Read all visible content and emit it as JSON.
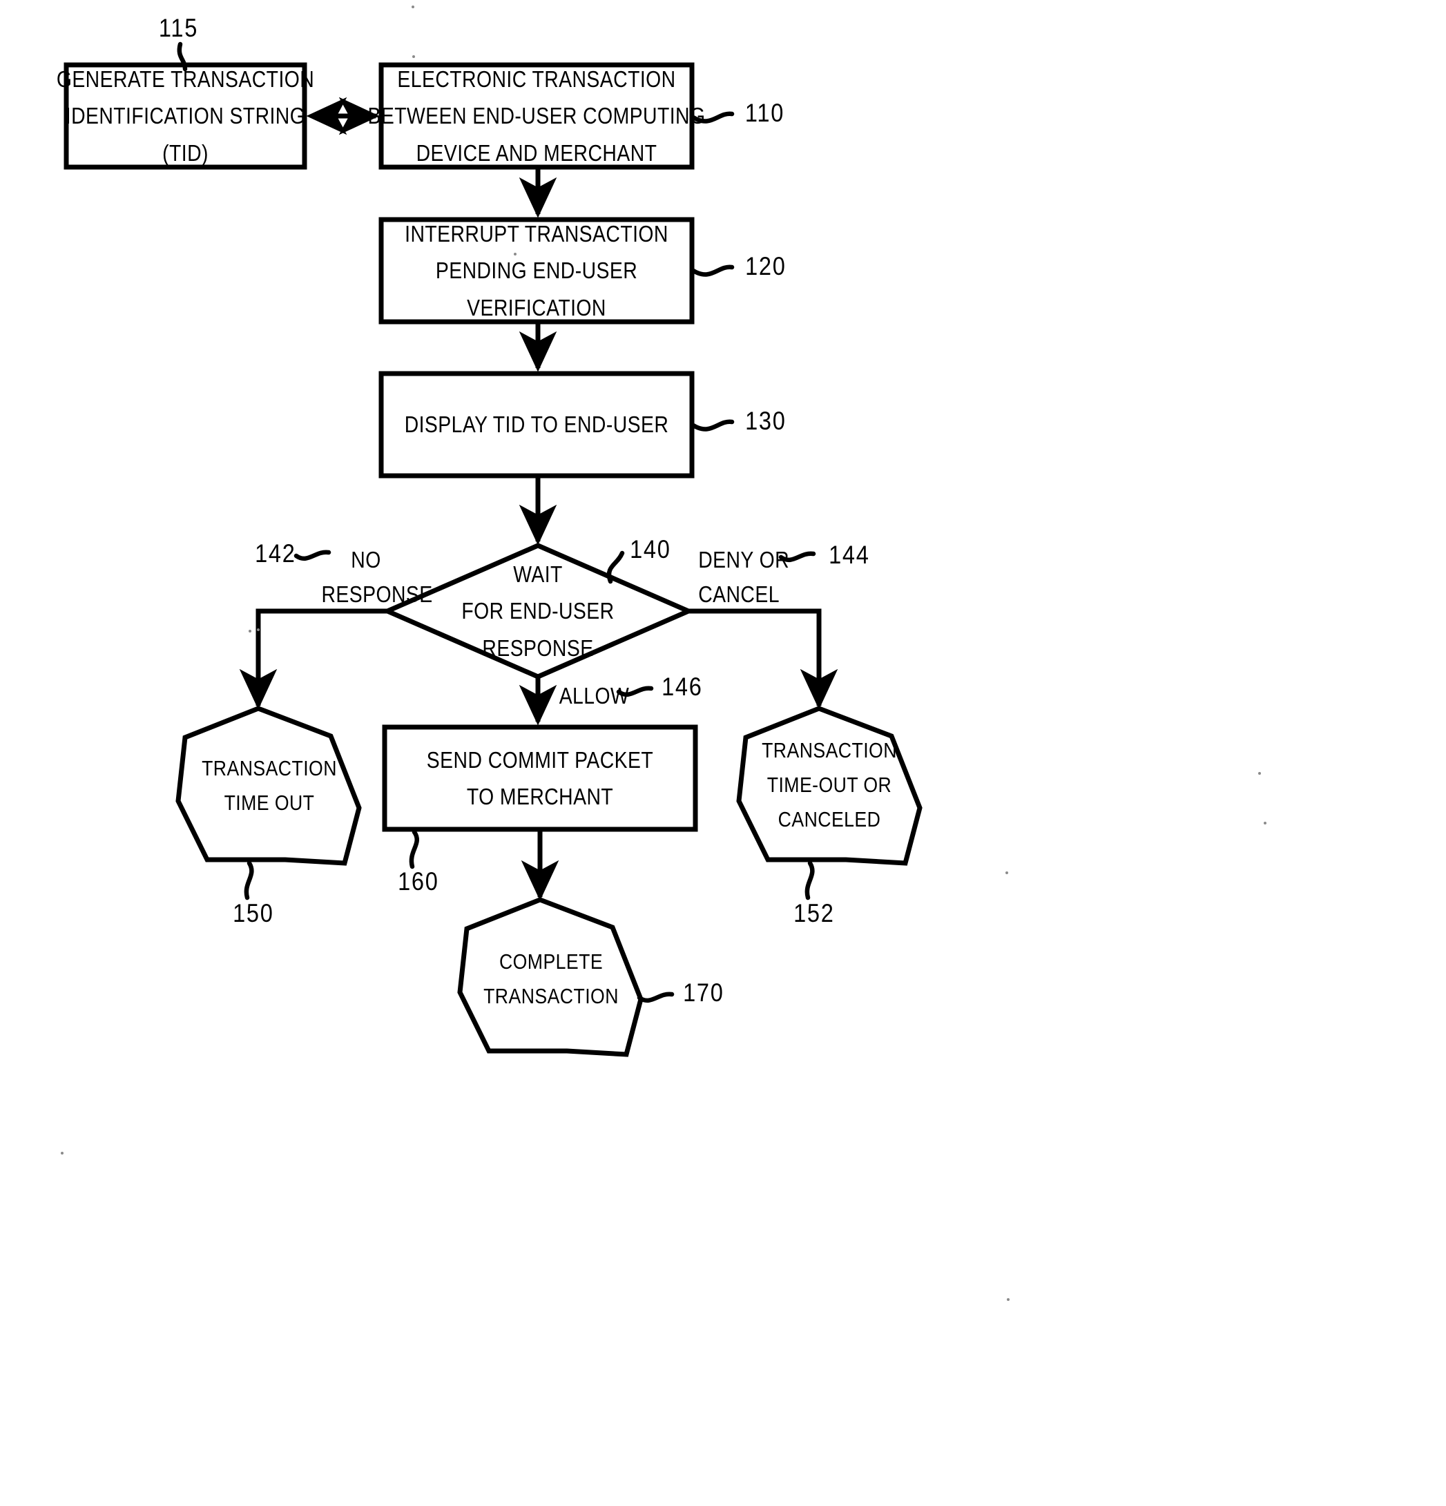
{
  "figure": {
    "type": "patent-flowchart",
    "background": "#ffffff",
    "stroke": "#000000"
  },
  "nodes": {
    "generate_tid": {
      "shape": "process-box",
      "ref": "115",
      "lines": [
        "GENERATE TRANSACTION",
        "IDENTIFICATION STRING",
        "(TID)"
      ]
    },
    "electronic_transaction": {
      "shape": "process-box",
      "ref": "110",
      "lines": [
        "ELECTRONIC TRANSACTION",
        "BETWEEN END-USER COMPUTING",
        "DEVICE AND MERCHANT"
      ]
    },
    "interrupt": {
      "shape": "process-box",
      "ref": "120",
      "lines": [
        "INTERRUPT TRANSACTION",
        "PENDING END-USER",
        "VERIFICATION"
      ]
    },
    "display_tid": {
      "shape": "process-box",
      "ref": "130",
      "lines": [
        "DISPLAY TID TO END-USER"
      ]
    },
    "wait_decision": {
      "shape": "diamond",
      "ref": "140",
      "lines": [
        "WAIT",
        "FOR END-USER",
        "RESPONSE"
      ]
    },
    "timeout_left": {
      "shape": "nonagon",
      "ref": "150",
      "lines": [
        "TRANSACTION",
        "TIME OUT"
      ]
    },
    "send_commit": {
      "shape": "process-box",
      "ref": "160",
      "lines": [
        "SEND COMMIT PACKET",
        "TO MERCHANT"
      ]
    },
    "timeout_canceled": {
      "shape": "nonagon",
      "ref": "152",
      "lines": [
        "TRANSACTION",
        "TIME-OUT OR",
        "CANCELED"
      ]
    },
    "complete": {
      "shape": "nonagon",
      "ref": "170",
      "lines": [
        "COMPLETE",
        "TRANSACTION"
      ]
    }
  },
  "edge_labels": {
    "no_response": {
      "ref": "142",
      "lines": [
        "NO",
        "RESPONSE"
      ]
    },
    "deny_or_cancel": {
      "ref": "144",
      "lines": [
        "DENY OR",
        "CANCEL"
      ]
    },
    "allow": {
      "ref": "146",
      "lines": [
        "ALLOW"
      ]
    }
  },
  "reference_numerals": {
    "n110": "110",
    "n115": "115",
    "n120": "120",
    "n130": "130",
    "n140": "140",
    "n142": "142",
    "n144": "144",
    "n146": "146",
    "n150": "150",
    "n152": "152",
    "n160": "160",
    "n170": "170"
  }
}
